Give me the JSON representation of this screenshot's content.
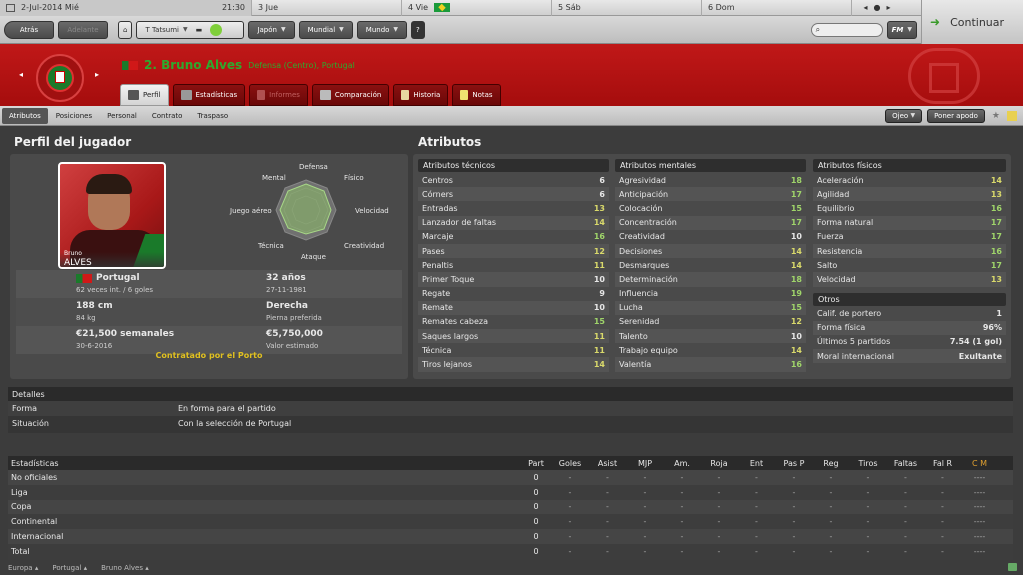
{
  "topbar": {
    "date": "2-Jul-2014 Mié",
    "time": "21:30",
    "days": [
      "3 Jue",
      "4 Vie",
      "5 Sáb",
      "6 Dom"
    ],
    "continue": "Continuar"
  },
  "nav": {
    "back": "Atrás",
    "forward": "Adelante",
    "manager": "T Tatsumi",
    "leagues": [
      "Japón",
      "Mundial",
      "Mundo"
    ],
    "help": "?",
    "fm": "FM"
  },
  "player": {
    "number_name": "2. Bruno Alves",
    "position": "Defensa (Centro), Portugal"
  },
  "tabs": [
    "Perfil",
    "Estadísticas",
    "Informes",
    "Comparación",
    "Historia",
    "Notas"
  ],
  "subtabs": [
    "Atributos",
    "Posiciones",
    "Personal",
    "Contrato",
    "Traspaso"
  ],
  "actions": {
    "ojeo": "Ojeo",
    "apodo": "Poner apodo"
  },
  "profile": {
    "title": "Perfil del jugador",
    "card_first": "Bruno",
    "card_last": "ALVES",
    "radar_labels": [
      "Defensa",
      "Físico",
      "Velocidad",
      "Creatividad",
      "Ataque",
      "Técnica",
      "Juego aéreo",
      "Mental"
    ],
    "nation": "Portugal",
    "caps": "62 veces int. / 6 goles",
    "age": "32 años",
    "dob": "27-11-1981",
    "height": "188 cm",
    "weight": "84 kg",
    "foot": "Derecha",
    "foot_label": "Pierna preferida",
    "wage": "€21,500 semanales",
    "contract_end": "30-6-2016",
    "value": "€5,750,000",
    "value_label": "Valor estimado",
    "status": "Contratado por el Porto"
  },
  "attributes": {
    "title": "Atributos",
    "technical": {
      "title": "Atributos técnicos",
      "items": [
        [
          "Centros",
          "6"
        ],
        [
          "Córners",
          "6"
        ],
        [
          "Entradas",
          "13"
        ],
        [
          "Lanzador de faltas",
          "14"
        ],
        [
          "Marcaje",
          "16"
        ],
        [
          "Pases",
          "12"
        ],
        [
          "Penaltis",
          "11"
        ],
        [
          "Primer Toque",
          "10"
        ],
        [
          "Regate",
          "9"
        ],
        [
          "Remate",
          "10"
        ],
        [
          "Remates cabeza",
          "15"
        ],
        [
          "Saques largos",
          "11"
        ],
        [
          "Técnica",
          "11"
        ],
        [
          "Tiros lejanos",
          "14"
        ]
      ]
    },
    "mental": {
      "title": "Atributos mentales",
      "items": [
        [
          "Agresividad",
          "18"
        ],
        [
          "Anticipación",
          "17"
        ],
        [
          "Colocación",
          "15"
        ],
        [
          "Concentración",
          "17"
        ],
        [
          "Creatividad",
          "10"
        ],
        [
          "Decisiones",
          "14"
        ],
        [
          "Desmarques",
          "14"
        ],
        [
          "Determinación",
          "18"
        ],
        [
          "Influencia",
          "19"
        ],
        [
          "Lucha",
          "15"
        ],
        [
          "Serenidad",
          "12"
        ],
        [
          "Talento",
          "10"
        ],
        [
          "Trabajo equipo",
          "14"
        ],
        [
          "Valentía",
          "16"
        ]
      ]
    },
    "physical": {
      "title": "Atributos físicos",
      "items": [
        [
          "Aceleración",
          "14"
        ],
        [
          "Agilidad",
          "13"
        ],
        [
          "Equilibrio",
          "16"
        ],
        [
          "Forma natural",
          "17"
        ],
        [
          "Fuerza",
          "17"
        ],
        [
          "Resistencia",
          "16"
        ],
        [
          "Salto",
          "17"
        ],
        [
          "Velocidad",
          "13"
        ]
      ]
    },
    "others": {
      "title": "Otros",
      "items": [
        [
          "Calif. de portero",
          "1"
        ],
        [
          "Forma física",
          "96%"
        ],
        [
          "Últimos 5 partidos",
          "7.54 (1 gol)"
        ],
        [
          "Moral internacional",
          "Exultante"
        ]
      ]
    }
  },
  "details": {
    "title": "Detalles",
    "rows": [
      [
        "Forma",
        "En forma para el partido"
      ],
      [
        "Situación",
        "Con la selección de Portugal"
      ]
    ]
  },
  "stats": {
    "title": "Estadísticas",
    "headers": [
      "Part",
      "Goles",
      "Asist",
      "MJP",
      "Am.",
      "Roja",
      "Ent",
      "Pas P",
      "Reg",
      "Tiros",
      "Faltas",
      "Fal R",
      "C M"
    ],
    "rows": [
      [
        "No oficiales",
        "0"
      ],
      [
        "Liga",
        "0"
      ],
      [
        "Copa",
        "0"
      ],
      [
        "Continental",
        "0"
      ],
      [
        "Internacional",
        "0"
      ],
      [
        "Total",
        "0"
      ]
    ],
    "dash": "-",
    "cm": "----"
  },
  "footer": [
    "Europa",
    "Portugal",
    "Bruno Alves"
  ],
  "colors": {
    "header_red": "#b81212",
    "green_val": "#9fd46a",
    "yellow_val": "#d9d96b",
    "gold": "#e0c020"
  }
}
